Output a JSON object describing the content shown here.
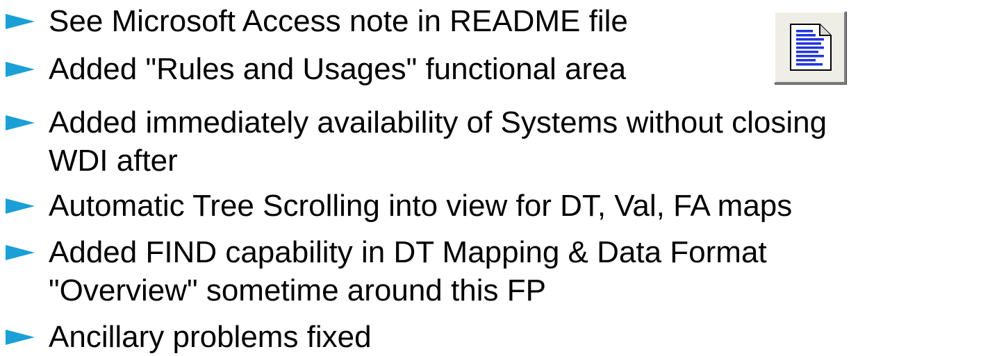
{
  "bullets": [
    {
      "lines": [
        "See Microsoft Access note in README file"
      ]
    },
    {
      "lines": [
        "Added \"Rules and Usages\" functional area"
      ]
    },
    {
      "lines": [
        "Added immediately availability of Systems without closing",
        "WDI after"
      ]
    },
    {
      "lines": [
        "Automatic Tree Scrolling into view for DT, Val, FA maps"
      ]
    },
    {
      "lines": [
        "Added FIND capability in DT Mapping & Data Format",
        "\"Overview\" sometime around this FP"
      ]
    },
    {
      "lines": [
        "Ancillary problems fixed"
      ]
    }
  ],
  "icon": {
    "name": "document-icon"
  },
  "colors": {
    "bullet": "#1aa0d6",
    "text": "#000000",
    "button_face": "#efeee6"
  }
}
